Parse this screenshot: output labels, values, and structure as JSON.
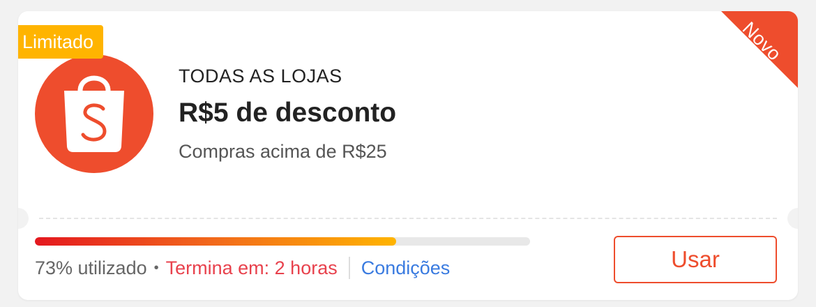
{
  "voucher": {
    "badge": "Limitado",
    "corner_tag": "Novo",
    "scope": "TODAS AS LOJAS",
    "title": "R$5 de desconto",
    "min_spend": "Compras acima de R$25",
    "usage": {
      "percent": 73,
      "label": "73% utilizado"
    },
    "ends": "Termina em: 2 horas",
    "conditions_link": "Condições",
    "use_button": "Usar"
  },
  "icons": {
    "logo": "shopee-bag-icon"
  },
  "colors": {
    "brand": "#ee4d2d",
    "badge": "#ffb400",
    "expiry": "#e8424d",
    "link": "#3a7be0",
    "progress_start": "#e4181f",
    "progress_end": "#ffb400"
  }
}
